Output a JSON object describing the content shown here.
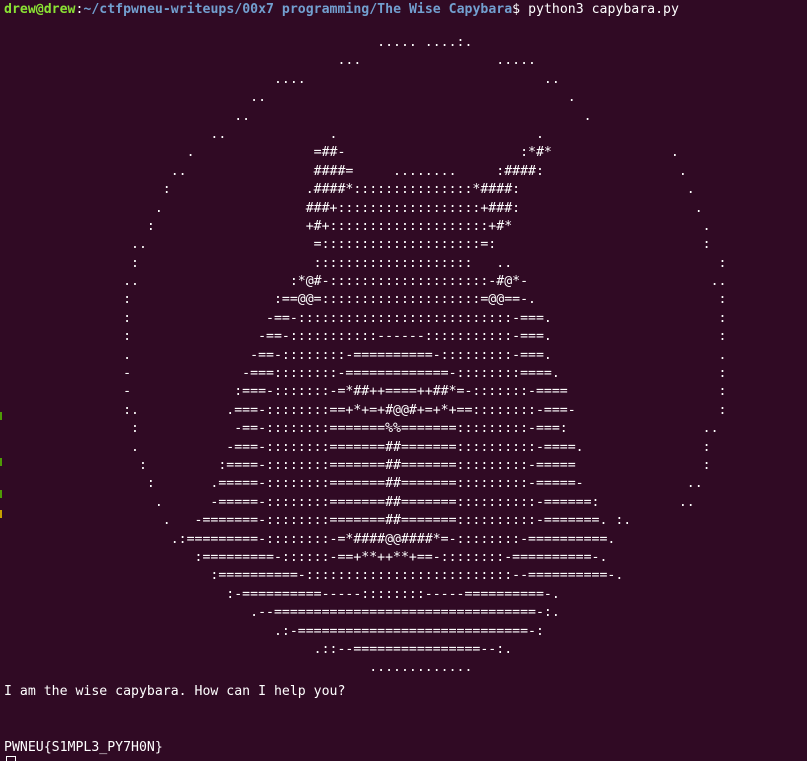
{
  "prompt": {
    "user_host": "drew@drew",
    "colon": ":",
    "path": "~/ctfpwneu-writeups/00x7 programming/The Wise Capybara",
    "dollar": "$ ",
    "command": "python3 capybara.py"
  },
  "ascii_art": [
    "                                               ..... ....:.",
    "                                          ...                 .....",
    "                                  ....                              ..",
    "                               ..                                      .",
    "                             ..                                          .",
    "                          ..             .                         .",
    "                       .               =##-                      :*#*               .",
    "                     ..                ####=     ........     :####:                 .",
    "                    :                 .####*:::::::::::::::*####:                     .",
    "                   .                  ###+::::::::::::::::::+###:                      .",
    "                  :                   +#+::::::::::::::::::::+#*                        .",
    "                ..                     =::::::::::::::::::::=:                          :",
    "                :                      ::::::::::::::::::::   ..                          :",
    "               ..                   :*@#-::::::::::::::::::::-#@*-                       ..",
    "               :                  :==@@=::::::::::::::::::::=@@==-.                       :",
    "               :                 -==-:::::::::::::::::::::::::::-===.                     :",
    "               :                -==-:::::::::::------:::::::::::-===.                     :",
    "               .               -==-::::::::-==========-:::::::::-===.                     .",
    "               -              -===::::::::-=============-::::::::====.                    :",
    "               -             :===-:::::::-=*##++====++##*=-:::::::-====                   :",
    "               :.           .===-::::::::==+*+=+#@@#+=+*+==::::::::-===-                  :",
    "                :            -==-::::::::=======%%=======:::::::::-===:                 ..",
    "                .           -===-::::::::=======##=======::::::::::-====.               :",
    "                 :         :====-::::::::=======##=======:::::::::-=====                :",
    "                  :       .=====-::::::::=======##=======:::::::::-=====-             ..",
    "                   .      -=====-::::::::=======##=======::::::::::-======:          ..",
    "                    .   -=======-::::::::=======##=======::::::::::-=======. :.",
    "                     .:=========-::::::::-=*####@@####*=-::::::::-==========.",
    "                        :=========-::::::-==+**++**+==-::::::::-==========-.",
    "                          :==========-::::::::::::::::::::::::::--==========-.",
    "                            :-==========-----::::::::-----==========-.",
    "                               .--=================================-:.",
    "                                  .:-=============================-:",
    "                                       .::--================--:.",
    "                                              ............."
  ],
  "output_text": "I am the wise capybara. How can I help you?",
  "flag_text": "PWNEU{S1MPL3_PY7H0N}",
  "colors": {
    "background": "#300a24",
    "user_host": "#8ae234",
    "path": "#729fcf",
    "text": "#ffffff"
  }
}
